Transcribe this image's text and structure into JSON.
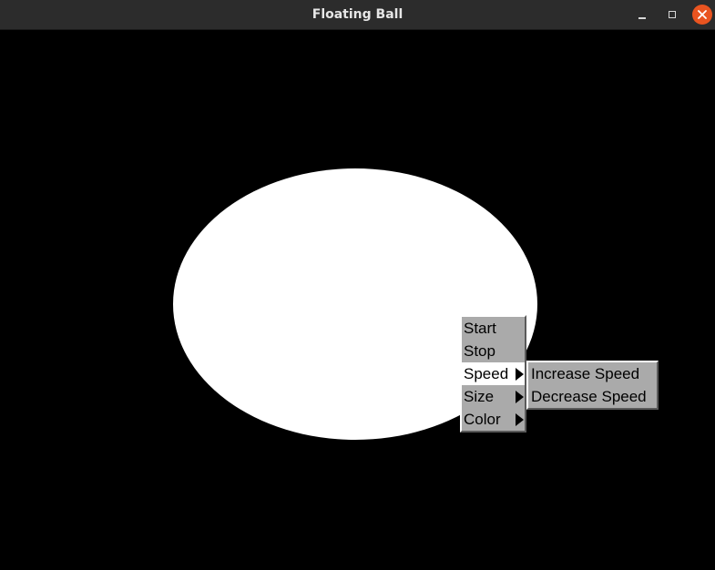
{
  "window": {
    "title": "Floating Ball"
  },
  "titlebar_buttons": {
    "minimize": "minimize-icon",
    "maximize": "maximize-icon",
    "close": "close-icon"
  },
  "colors": {
    "titlebar": "#2c2c2c",
    "close_button": "#e95420",
    "canvas_background": "#000000",
    "ball": "#ffffff",
    "menu_background": "#aaaaaa",
    "menu_highlight": "#ffffff"
  },
  "context_menu": {
    "items": [
      {
        "label": "Start",
        "has_submenu": false
      },
      {
        "label": "Stop",
        "has_submenu": false
      },
      {
        "label": "Speed",
        "has_submenu": true,
        "active": true
      },
      {
        "label": "Size",
        "has_submenu": true
      },
      {
        "label": "Color",
        "has_submenu": true
      }
    ]
  },
  "speed_submenu": {
    "items": [
      {
        "label": "Increase Speed"
      },
      {
        "label": "Decrease Speed"
      }
    ]
  }
}
